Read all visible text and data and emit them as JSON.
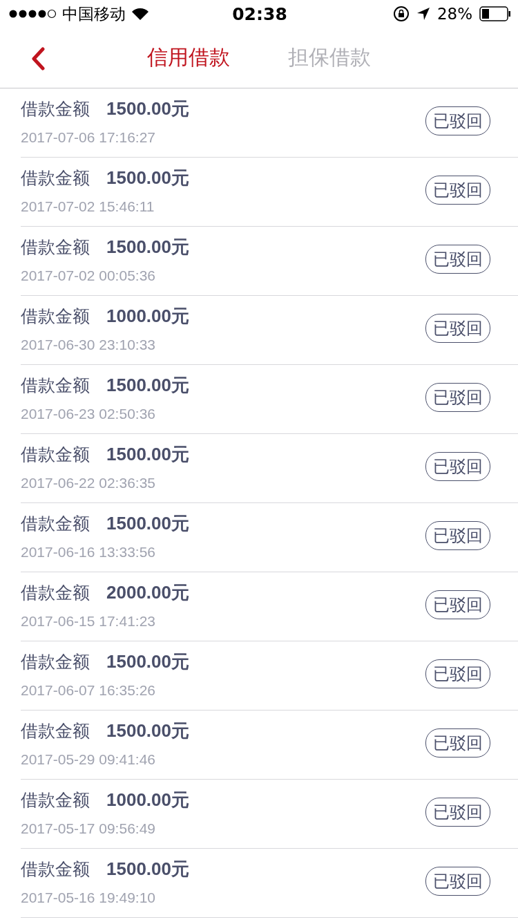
{
  "status_bar": {
    "carrier": "中国移动",
    "time": "02:38",
    "battery": "28%"
  },
  "nav": {
    "tabs": [
      {
        "label": "信用借款",
        "selected": true
      },
      {
        "label": "担保借款",
        "selected": false
      }
    ]
  },
  "loans": [
    {
      "label": "借款金额",
      "amount": "1500.00元",
      "date": "2017-07-06 17:16:27",
      "status": "已驳回"
    },
    {
      "label": "借款金额",
      "amount": "1500.00元",
      "date": "2017-07-02 15:46:11",
      "status": "已驳回"
    },
    {
      "label": "借款金额",
      "amount": "1500.00元",
      "date": "2017-07-02 00:05:36",
      "status": "已驳回"
    },
    {
      "label": "借款金额",
      "amount": "1000.00元",
      "date": "2017-06-30 23:10:33",
      "status": "已驳回"
    },
    {
      "label": "借款金额",
      "amount": "1500.00元",
      "date": "2017-06-23 02:50:36",
      "status": "已驳回"
    },
    {
      "label": "借款金额",
      "amount": "1500.00元",
      "date": "2017-06-22 02:36:35",
      "status": "已驳回"
    },
    {
      "label": "借款金额",
      "amount": "1500.00元",
      "date": "2017-06-16 13:33:56",
      "status": "已驳回"
    },
    {
      "label": "借款金额",
      "amount": "2000.00元",
      "date": "2017-06-15 17:41:23",
      "status": "已驳回"
    },
    {
      "label": "借款金额",
      "amount": "1500.00元",
      "date": "2017-06-07 16:35:26",
      "status": "已驳回"
    },
    {
      "label": "借款金额",
      "amount": "1500.00元",
      "date": "2017-05-29 09:41:46",
      "status": "已驳回"
    },
    {
      "label": "借款金额",
      "amount": "1000.00元",
      "date": "2017-05-17 09:56:49",
      "status": "已驳回"
    },
    {
      "label": "借款金额",
      "amount": "1500.00元",
      "date": "2017-05-16 19:49:10",
      "status": "已驳回"
    }
  ]
}
